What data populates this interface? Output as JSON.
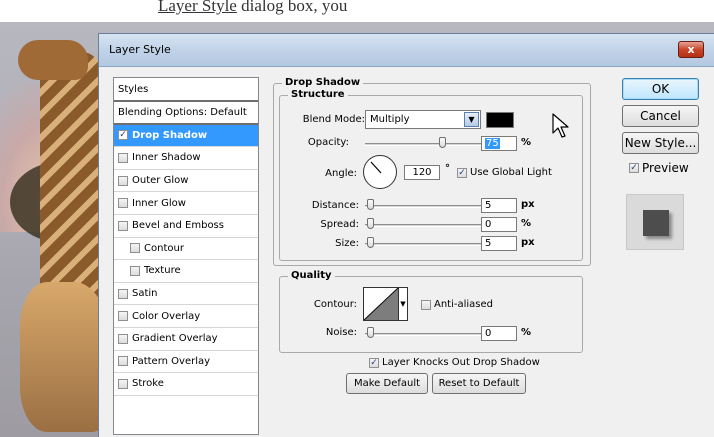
{
  "background": {
    "tutorial_text_plain": "",
    "tutorial_text_underlined": "Layer Style",
    "tutorial_text_tail": " dialog box, you"
  },
  "dialog": {
    "title": "Layer Style",
    "close_label": "x"
  },
  "styles_panel": {
    "header": "Styles",
    "items": [
      {
        "label": "Blending Options: Default",
        "checkbox": false,
        "checked": false,
        "selected": false,
        "indent": false
      },
      {
        "label": "Drop Shadow",
        "checkbox": true,
        "checked": true,
        "selected": true,
        "indent": false
      },
      {
        "label": "Inner Shadow",
        "checkbox": true,
        "checked": false,
        "selected": false,
        "indent": false
      },
      {
        "label": "Outer Glow",
        "checkbox": true,
        "checked": false,
        "selected": false,
        "indent": false
      },
      {
        "label": "Inner Glow",
        "checkbox": true,
        "checked": false,
        "selected": false,
        "indent": false
      },
      {
        "label": "Bevel and Emboss",
        "checkbox": true,
        "checked": false,
        "selected": false,
        "indent": false
      },
      {
        "label": "Contour",
        "checkbox": true,
        "checked": false,
        "selected": false,
        "indent": true
      },
      {
        "label": "Texture",
        "checkbox": true,
        "checked": false,
        "selected": false,
        "indent": true
      },
      {
        "label": "Satin",
        "checkbox": true,
        "checked": false,
        "selected": false,
        "indent": false
      },
      {
        "label": "Color Overlay",
        "checkbox": true,
        "checked": false,
        "selected": false,
        "indent": false
      },
      {
        "label": "Gradient Overlay",
        "checkbox": true,
        "checked": false,
        "selected": false,
        "indent": false
      },
      {
        "label": "Pattern Overlay",
        "checkbox": true,
        "checked": false,
        "selected": false,
        "indent": false
      },
      {
        "label": "Stroke",
        "checkbox": true,
        "checked": false,
        "selected": false,
        "indent": false
      }
    ]
  },
  "drop_shadow": {
    "group_title": "Drop Shadow",
    "structure_title": "Structure",
    "blend_mode_label": "Blend Mode:",
    "blend_mode_value": "Multiply",
    "shadow_color": "#000000",
    "opacity_label": "Opacity:",
    "opacity_value": "75",
    "opacity_unit": "%",
    "angle_label": "Angle:",
    "angle_value": "120",
    "angle_unit": "°",
    "use_global_light_label": "Use Global Light",
    "use_global_light_checked": true,
    "distance_label": "Distance:",
    "distance_value": "5",
    "distance_unit": "px",
    "spread_label": "Spread:",
    "spread_value": "0",
    "spread_unit": "%",
    "size_label": "Size:",
    "size_value": "5",
    "size_unit": "px"
  },
  "quality": {
    "group_title": "Quality",
    "contour_label": "Contour:",
    "anti_aliased_label": "Anti-aliased",
    "anti_aliased_checked": false,
    "noise_label": "Noise:",
    "noise_value": "0",
    "noise_unit": "%"
  },
  "bottom": {
    "knocks_out_label": "Layer Knocks Out Drop Shadow",
    "knocks_out_checked": true,
    "make_default_label": "Make Default",
    "reset_default_label": "Reset to Default"
  },
  "buttons": {
    "ok": "OK",
    "cancel": "Cancel",
    "new_style": "New Style...",
    "preview_label": "Preview",
    "preview_checked": true
  },
  "colors": {
    "selection": "#3399ff",
    "titlebar": "#c1d3e8",
    "close": "#c9462b"
  },
  "icons": {
    "close": "close-x-icon",
    "dropdown": "chevron-down-icon",
    "cursor": "mouse-pointer-icon",
    "angle": "angle-dial-icon",
    "contour": "contour-curve-icon"
  }
}
